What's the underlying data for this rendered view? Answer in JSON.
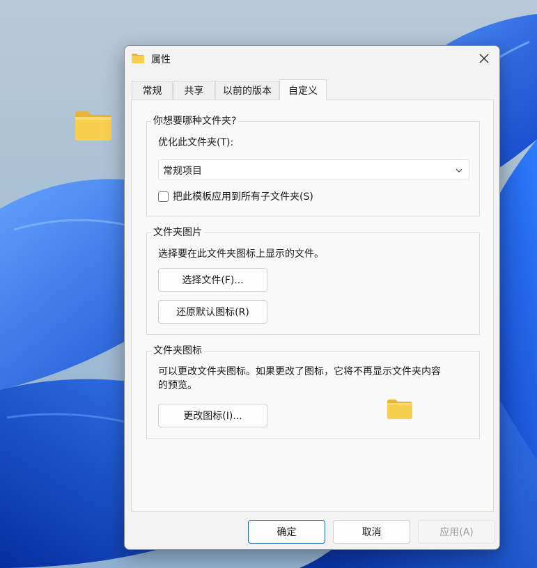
{
  "window": {
    "title": "属性",
    "close_icon": "close-icon",
    "folder_icon": "folder-icon"
  },
  "tabs": [
    {
      "label": "常规",
      "active": false
    },
    {
      "label": "共享",
      "active": false
    },
    {
      "label": "以前的版本",
      "active": false
    },
    {
      "label": "自定义",
      "active": true
    }
  ],
  "folder_type": {
    "legend": "你想要哪种文件夹?",
    "optimize_label": "优化此文件夹(T):",
    "selected_value": "常规项目",
    "apply_subfolders_label": "把此模板应用到所有子文件夹(S)",
    "apply_subfolders_checked": false
  },
  "folder_picture": {
    "legend": "文件夹图片",
    "description": "选择要在此文件夹图标上显示的文件。",
    "choose_file_label": "选择文件(F)...",
    "restore_default_label": "还原默认图标(R)"
  },
  "folder_icon_group": {
    "legend": "文件夹图标",
    "description_line1": "可以更改文件夹图标。如果更改了图标，它将不再显示文件夹内容",
    "description_line2": "的预览。",
    "change_icon_label": "更改图标(I)..."
  },
  "footer": {
    "ok_label": "确定",
    "cancel_label": "取消",
    "apply_label": "应用(A)"
  },
  "colors": {
    "accent": "#1b65b8",
    "folder_yellow": "#f8cf4f",
    "wallpaper_blue": "#1d5fe0"
  }
}
